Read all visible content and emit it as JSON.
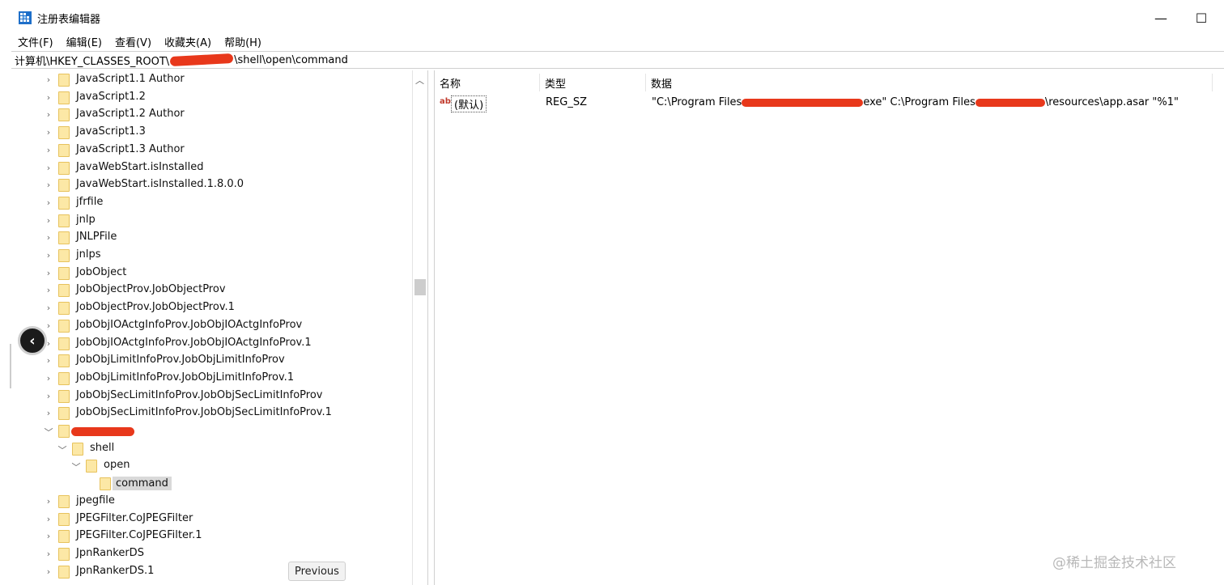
{
  "window": {
    "title": "注册表编辑器",
    "app_icon": "regedit-icon",
    "minimize_glyph": "—",
    "maximize_glyph": "☐"
  },
  "menu": [
    "文件(F)",
    "编辑(E)",
    "查看(V)",
    "收藏夹(A)",
    "帮助(H)"
  ],
  "address": {
    "prefix": "计算机\\HKEY_CLASSES_ROOT\\",
    "suffix": "\\shell\\open\\command"
  },
  "tree": {
    "items": [
      {
        "label": "JavaScript1.1 Author"
      },
      {
        "label": "JavaScript1.2"
      },
      {
        "label": "JavaScript1.2 Author"
      },
      {
        "label": "JavaScript1.3"
      },
      {
        "label": "JavaScript1.3 Author"
      },
      {
        "label": "JavaWebStart.isInstalled"
      },
      {
        "label": "JavaWebStart.isInstalled.1.8.0.0"
      },
      {
        "label": "jfrfile"
      },
      {
        "label": "jnlp"
      },
      {
        "label": "JNLPFile"
      },
      {
        "label": "jnlps"
      },
      {
        "label": "JobObject"
      },
      {
        "label": "JobObjectProv.JobObjectProv"
      },
      {
        "label": "JobObjectProv.JobObjectProv.1"
      },
      {
        "label": "JobObjIOActgInfoProv.JobObjIOActgInfoProv"
      },
      {
        "label": "JobObjIOActgInfoProv.JobObjIOActgInfoProv.1"
      },
      {
        "label": "JobObjLimitInfoProv.JobObjLimitInfoProv"
      },
      {
        "label": "JobObjLimitInfoProv.JobObjLimitInfoProv.1"
      },
      {
        "label": "JobObjSecLimitInfoProv.JobObjSecLimitInfoProv"
      },
      {
        "label": "JobObjSecLimitInfoProv.JobObjSecLimitInfoProv.1"
      }
    ],
    "expanded": {
      "shell": "shell",
      "open": "open",
      "command": "command"
    },
    "after_items": [
      {
        "label": "jpegfile"
      },
      {
        "label": "JPEGFilter.CoJPEGFilter"
      },
      {
        "label": "JPEGFilter.CoJPEGFilter.1"
      },
      {
        "label": "JpnRankerDS"
      },
      {
        "label": "JpnRankerDS.1"
      }
    ]
  },
  "values": {
    "headers": {
      "name": "名称",
      "type": "类型",
      "data": "数据"
    },
    "rows": [
      {
        "icon": "string-value-icon",
        "icon_text": "ab",
        "name": "(默认)",
        "type": "REG_SZ",
        "data_part1": "\"C:\\Program Files",
        "data_part2": "exe\" C:\\Program Files",
        "data_part3": "\\resources\\app.asar \"%1\""
      }
    ]
  },
  "overlay": {
    "previous_label": "Previous",
    "back_icon": "chevron-left-icon"
  },
  "watermark": "@稀土掘金技术社区",
  "colors": {
    "redaction": "#e8381b",
    "folder": "#fce8a6",
    "selection": "#d9d9d9"
  }
}
